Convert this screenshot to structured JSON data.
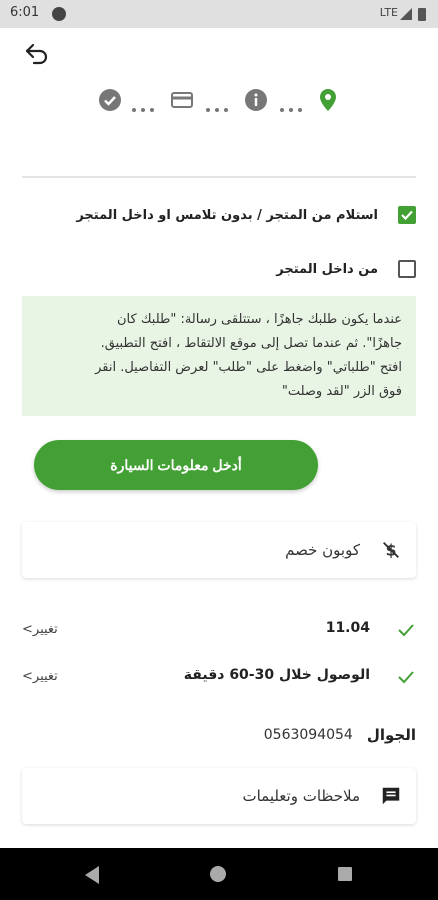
{
  "status": {
    "time": "6:01",
    "network": "LTE"
  },
  "options": [
    {
      "label": "استلام من المتجر / بدون تلامس او داخل المتجر",
      "checked": true
    },
    {
      "label": "من داخل المتجر",
      "checked": false
    }
  ],
  "info_lines": [
    "عندما يكون طلبك جاهزًا ، ستتلقى رسالة: \"طلبك كان",
    "جاهزًا\". ثم عندما تصل إلى موقع الالتقاط ، افتح التطبيق.",
    "افتح \"طلباتي\" واضغط على \"طلب\" لعرض التفاصيل. انقر",
    "فوق الزر \"لقد وصلت\""
  ],
  "car_button": "أدخل معلومات السيارة",
  "coupon": "كوبون خصم",
  "time_row": {
    "value": "11.04",
    "change": "تغيير>"
  },
  "arrival_row": {
    "value": "الوصول خلال 30-60 دقيقة",
    "change": "تغيير>"
  },
  "phone": {
    "label": "الجوال",
    "value": "0563094054"
  },
  "notes": "ملاحظات وتعليمات",
  "colors": {
    "accent": "#43a035",
    "info_bg": "#e8f4e4"
  },
  "icons": [
    "back-arrow-icon",
    "check-circle-icon",
    "card-icon",
    "info-icon",
    "location-pin-icon",
    "coupon-off-icon",
    "check-icon",
    "message-icon"
  ]
}
